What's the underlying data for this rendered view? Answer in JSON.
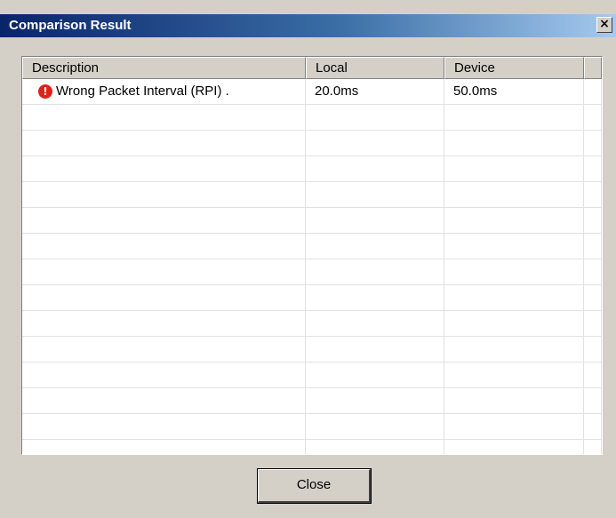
{
  "window": {
    "title": "Comparison Result",
    "close_glyph": "×"
  },
  "table": {
    "columns": [
      "Description",
      "Local",
      "Device"
    ],
    "rows": [
      {
        "icon": "error-icon",
        "description": "Wrong Packet Interval (RPI) .",
        "local": "20.0ms",
        "device": "50.0ms"
      }
    ]
  },
  "buttons": {
    "close_label": "Close"
  }
}
